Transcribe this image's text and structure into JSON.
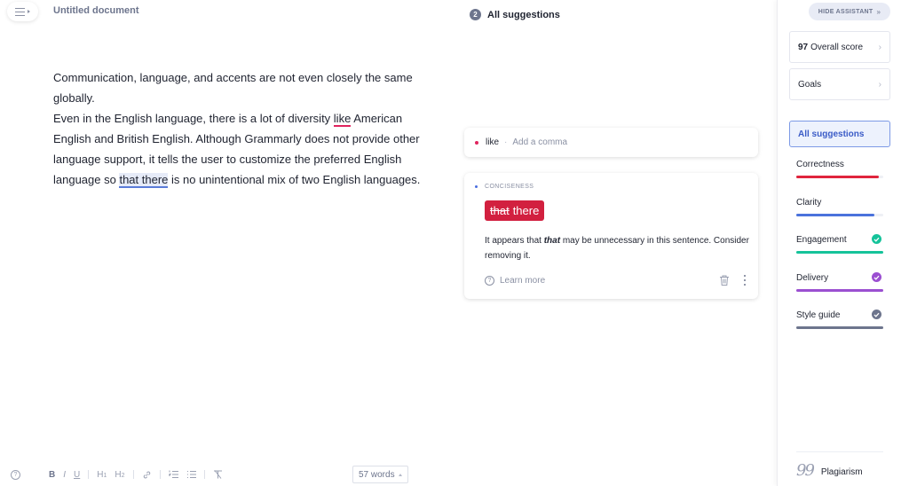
{
  "header": {
    "doc_title": "Untitled document"
  },
  "editor": {
    "paragraph1": "Communication, language, and accents are not even closely the same globally.",
    "paragraph2_pre": "Even in the English language, there is a lot of diversity ",
    "paragraph2_flag1": "like",
    "paragraph2_mid": " American English and British English. Although Grammarly does not provide other language support, it tells the user to customize the preferred English language so ",
    "paragraph2_flag2": "that there",
    "paragraph2_post": " is no unintentional mix of two English languages."
  },
  "suggestions": {
    "count": "2",
    "title": "All suggestions",
    "collapsed": {
      "word": "like",
      "separator": "·",
      "description": "Add a comma",
      "dot_color": "#e0245e"
    },
    "expanded": {
      "category": "CONCISENESS",
      "strike_word": "that",
      "keep_word": "there",
      "explanation_pre": "It appears that ",
      "explanation_em": "that",
      "explanation_post": " may be unnecessary in this sentence. Consider removing it.",
      "learn_more": "Learn more",
      "learn_icon": "?",
      "chip_color": "#d2203f"
    }
  },
  "toolbar": {
    "help_icon": "?",
    "bold": "B",
    "italic": "I",
    "underline": "U",
    "h1": "H",
    "h1_sub": "1",
    "h2": "H",
    "h2_sub": "2",
    "link_icon": "⛓",
    "ordered_list_icon": "⅓☰",
    "bullet_list_icon": "☷",
    "clear_format_icon": "T̸",
    "word_count": "57 words"
  },
  "sidebar": {
    "hide_label": "HIDE ASSISTANT",
    "hide_chevron": "»",
    "score_value": "97",
    "score_label": "Overall score",
    "goals_label": "Goals",
    "chevron": "›",
    "all_suggestions": "All suggestions",
    "categories": [
      {
        "label": "Correctness",
        "color": "#e0243d",
        "progress": 0.95,
        "done": false
      },
      {
        "label": "Clarity",
        "color": "#4a72dc",
        "progress": 0.9,
        "done": false
      },
      {
        "label": "Engagement",
        "color": "#15c39a",
        "progress": 1.0,
        "done": true
      },
      {
        "label": "Delivery",
        "color": "#9b4fd1",
        "progress": 1.0,
        "done": true
      },
      {
        "label": "Style guide",
        "color": "#6d758d",
        "progress": 1.0,
        "done": true
      }
    ],
    "plagiarism_icon": "99",
    "plagiarism_label": "Plagiarism"
  }
}
